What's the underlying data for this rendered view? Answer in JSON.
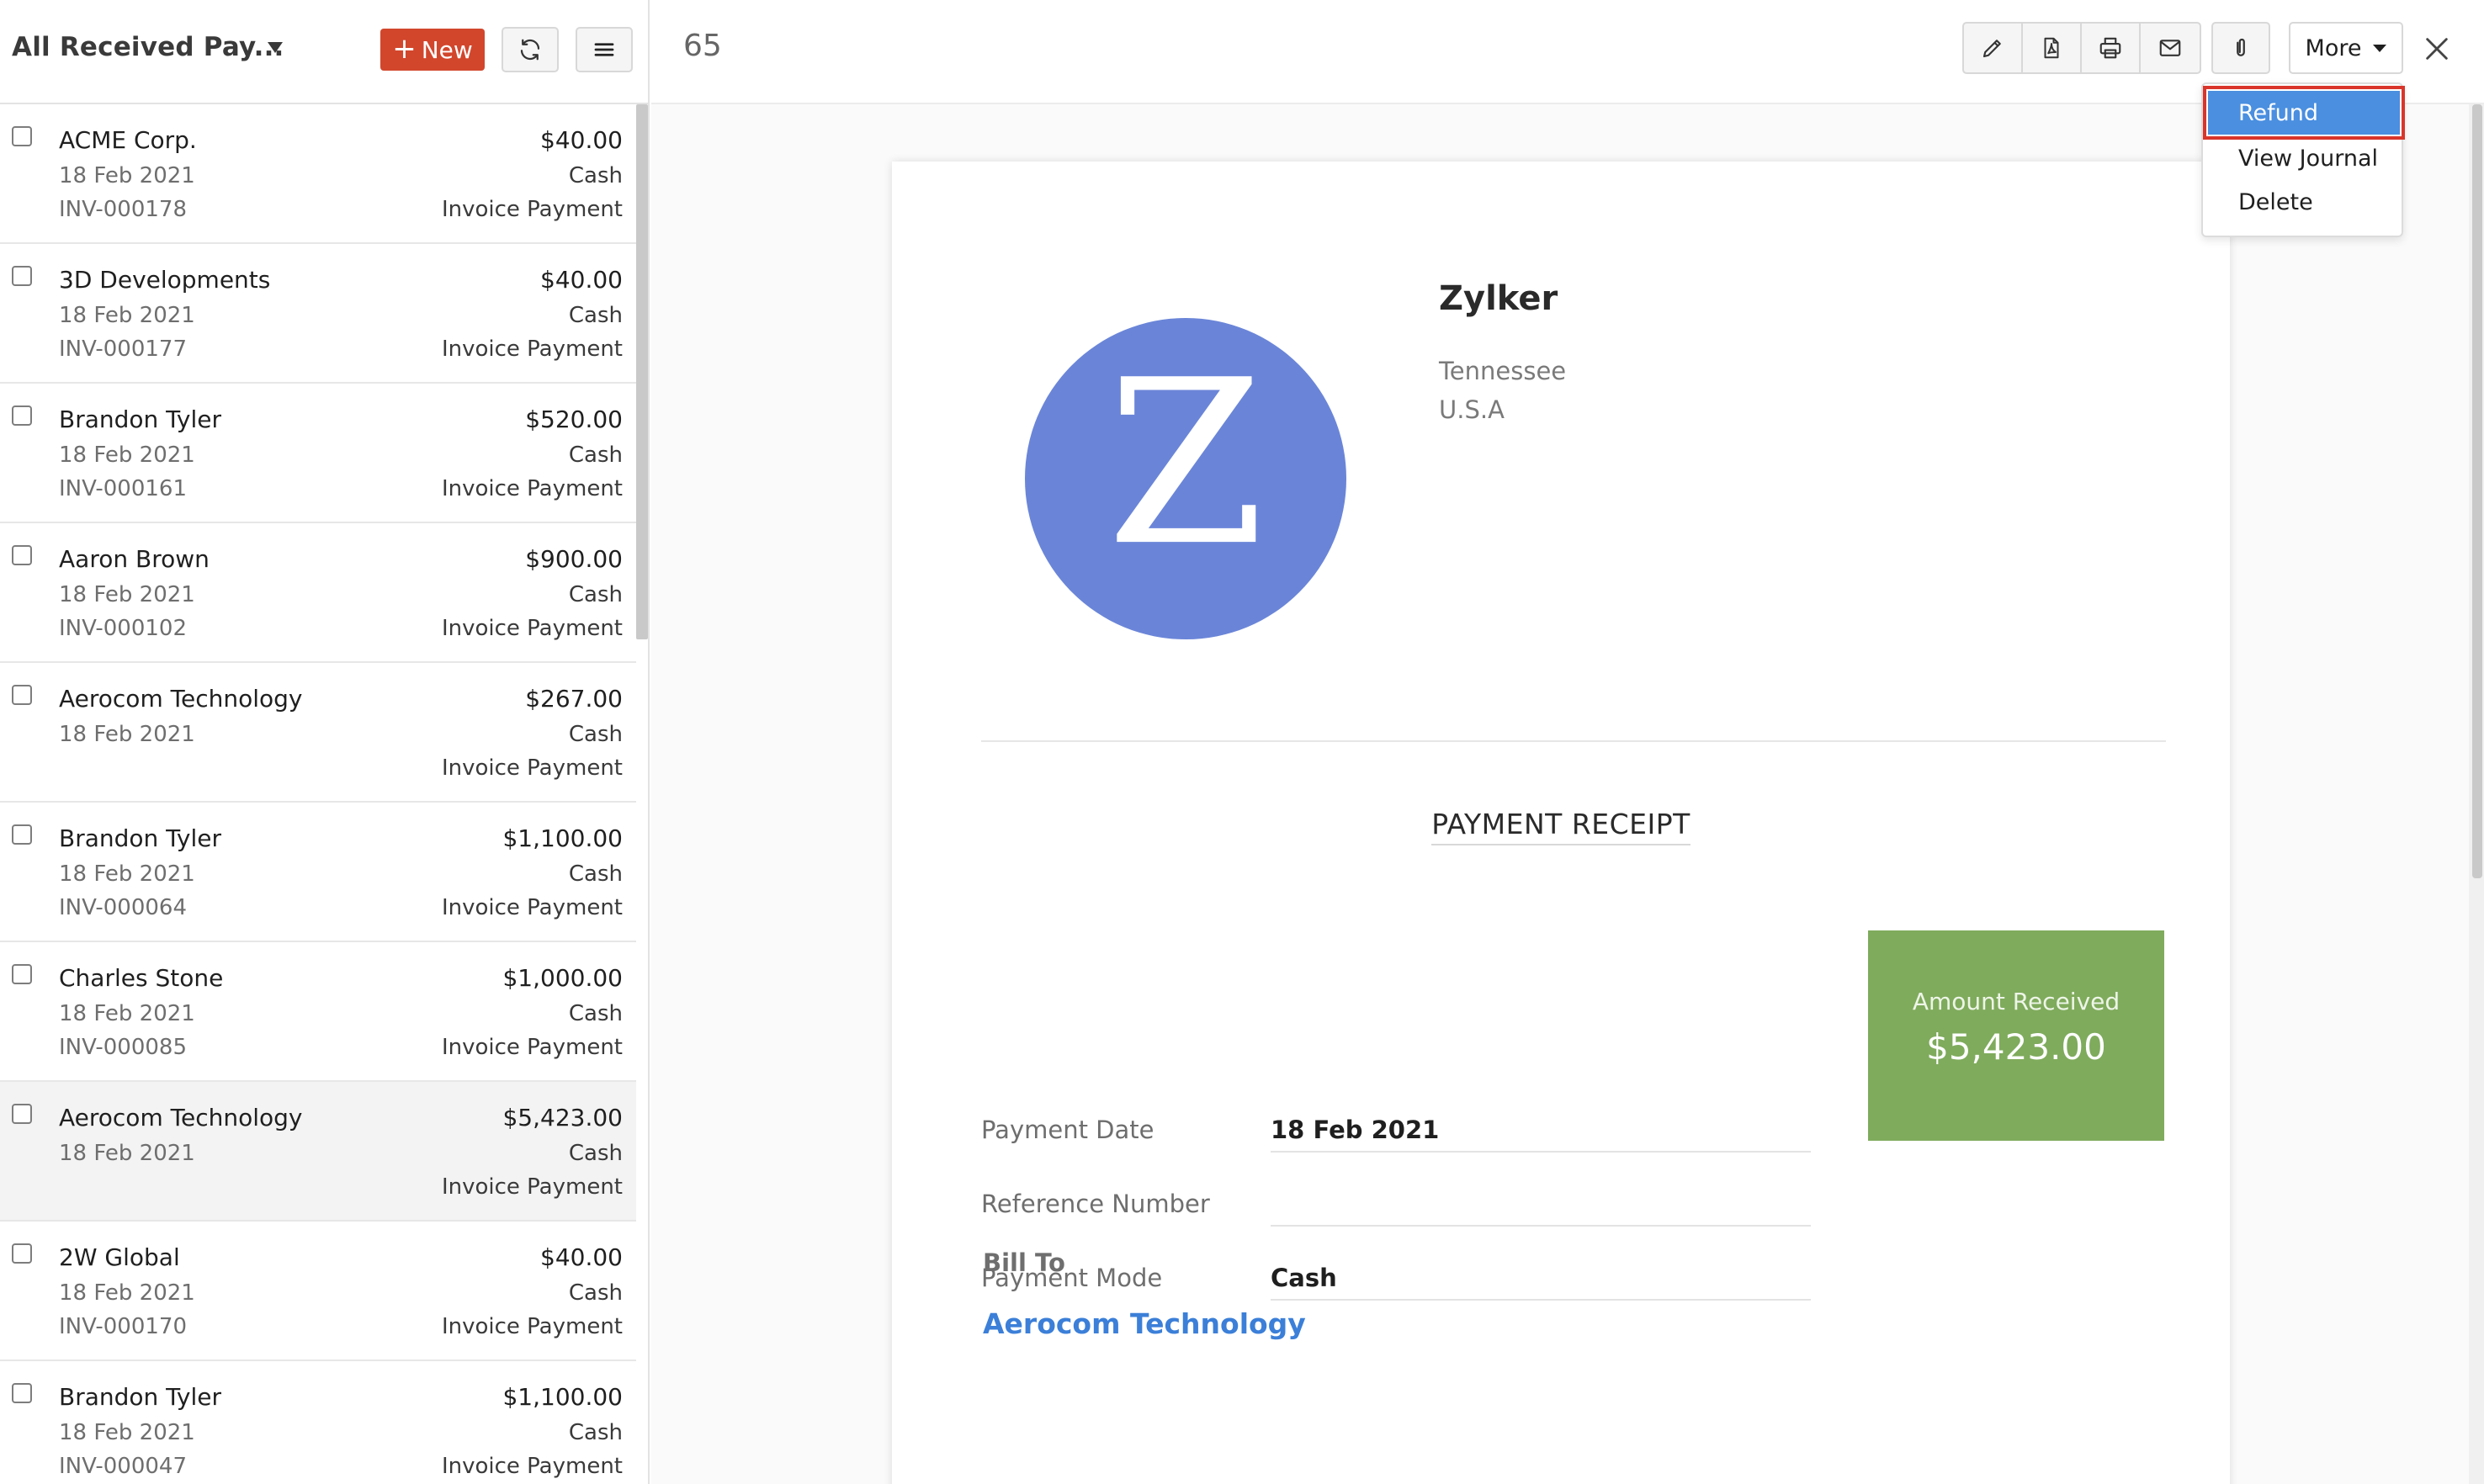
{
  "list_header": {
    "view_title": "All Received Pay...",
    "new_button": "New",
    "new_plus": "+"
  },
  "payments": [
    {
      "customer": "ACME Corp.",
      "date": "18 Feb 2021",
      "invoice": "INV-000178",
      "amount": "$40.00",
      "mode": "Cash",
      "type": "Invoice Payment",
      "selected": false
    },
    {
      "customer": "3D Developments",
      "date": "18 Feb 2021",
      "invoice": "INV-000177",
      "amount": "$40.00",
      "mode": "Cash",
      "type": "Invoice Payment",
      "selected": false
    },
    {
      "customer": "Brandon Tyler",
      "date": "18 Feb 2021",
      "invoice": "INV-000161",
      "amount": "$520.00",
      "mode": "Cash",
      "type": "Invoice Payment",
      "selected": false
    },
    {
      "customer": "Aaron Brown",
      "date": "18 Feb 2021",
      "invoice": "INV-000102",
      "amount": "$900.00",
      "mode": "Cash",
      "type": "Invoice Payment",
      "selected": false
    },
    {
      "customer": "Aerocom Technology",
      "date": "18 Feb 2021",
      "invoice": "",
      "amount": "$267.00",
      "mode": "Cash",
      "type": "Invoice Payment",
      "selected": false
    },
    {
      "customer": "Brandon Tyler",
      "date": "18 Feb 2021",
      "invoice": "INV-000064",
      "amount": "$1,100.00",
      "mode": "Cash",
      "type": "Invoice Payment",
      "selected": false
    },
    {
      "customer": "Charles Stone",
      "date": "18 Feb 2021",
      "invoice": "INV-000085",
      "amount": "$1,000.00",
      "mode": "Cash",
      "type": "Invoice Payment",
      "selected": false
    },
    {
      "customer": "Aerocom Technology",
      "date": "18 Feb 2021",
      "invoice": "",
      "amount": "$5,423.00",
      "mode": "Cash",
      "type": "Invoice Payment",
      "selected": true
    },
    {
      "customer": "2W Global",
      "date": "18 Feb 2021",
      "invoice": "INV-000170",
      "amount": "$40.00",
      "mode": "Cash",
      "type": "Invoice Payment",
      "selected": false
    },
    {
      "customer": "Brandon Tyler",
      "date": "18 Feb 2021",
      "invoice": "INV-000047",
      "amount": "$1,100.00",
      "mode": "Cash",
      "type": "Invoice Payment",
      "selected": false
    }
  ],
  "detail": {
    "record_number": "65",
    "more_button": "More",
    "more_menu": {
      "refund": "Refund",
      "view_journal": "View Journal",
      "delete": "Delete"
    },
    "icons": [
      "pencil-icon",
      "pdf-icon",
      "print-icon",
      "mail-icon",
      "paperclip-icon",
      "close-icon",
      "refresh-icon",
      "hamburger-icon"
    ]
  },
  "receipt": {
    "logo_letter": "Z",
    "organization": "Zylker",
    "state": "Tennessee",
    "country": "U.S.A",
    "title": "PAYMENT RECEIPT",
    "fields": {
      "payment_date_label": "Payment Date",
      "payment_date": "18 Feb 2021",
      "reference_label": "Reference Number",
      "reference": "",
      "mode_label": "Payment Mode",
      "mode": "Cash"
    },
    "amount_label": "Amount Received",
    "amount": "$5,423.00",
    "bill_to_label": "Bill To",
    "bill_to": "Aerocom Technology"
  },
  "colors": {
    "new_button": "#d2462c",
    "logo_circle": "#6a85d8",
    "amount_box": "#7fab5c",
    "link": "#3b7fd8",
    "menu_highlight": "#4a8fe0",
    "highlight_outline": "#d9352a"
  }
}
